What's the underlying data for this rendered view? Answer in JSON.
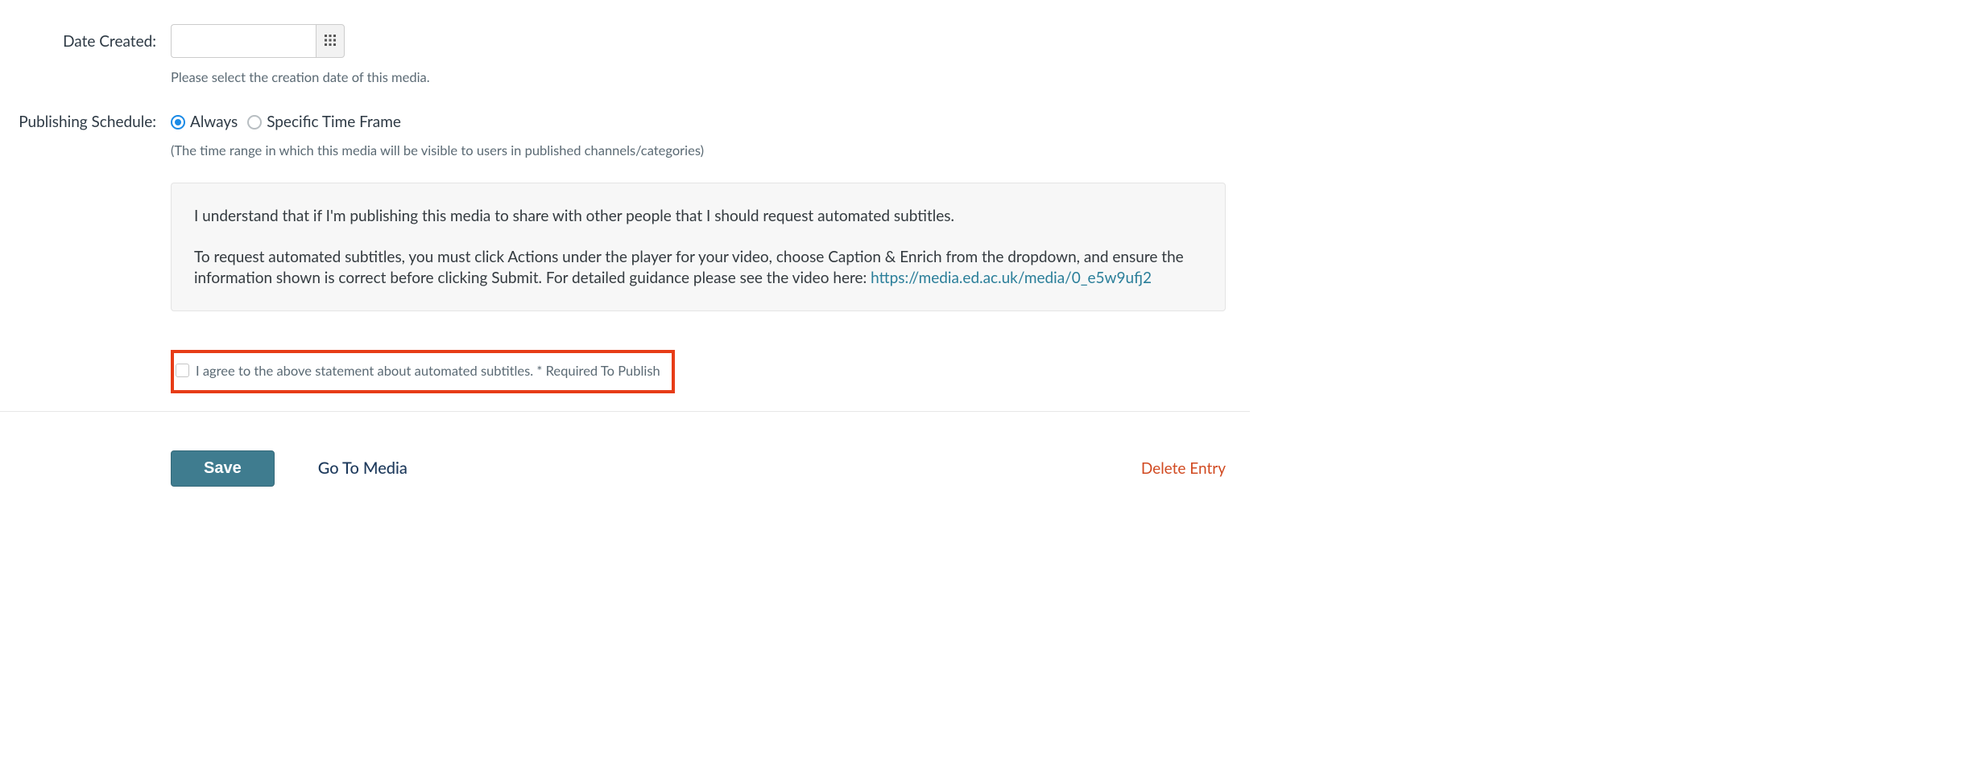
{
  "dateCreated": {
    "label": "Date Created:",
    "value": "",
    "help": "Please select the creation date of this media."
  },
  "publishingSchedule": {
    "label": "Publishing Schedule:",
    "options": {
      "always": "Always",
      "specific": "Specific Time Frame"
    },
    "help": "(The time range in which this media will be visible to users in published channels/categories)"
  },
  "infoBox": {
    "para1": "I understand that if I'm publishing this media to share with other people that I should request automated subtitles.",
    "para2a": "To request automated subtitles, you must click Actions under the player for your video, choose Caption & Enrich from the dropdown, and ensure the information shown is correct before clicking Submit.  For detailed guidance please see the video here: ",
    "linkText": "https://media.ed.ac.uk/media/0_e5w9ufj2"
  },
  "agree": {
    "text": "I agree to the above statement about automated subtitles. * Required To Publish"
  },
  "actions": {
    "save": "Save",
    "goToMedia": "Go To Media",
    "delete": "Delete Entry"
  }
}
